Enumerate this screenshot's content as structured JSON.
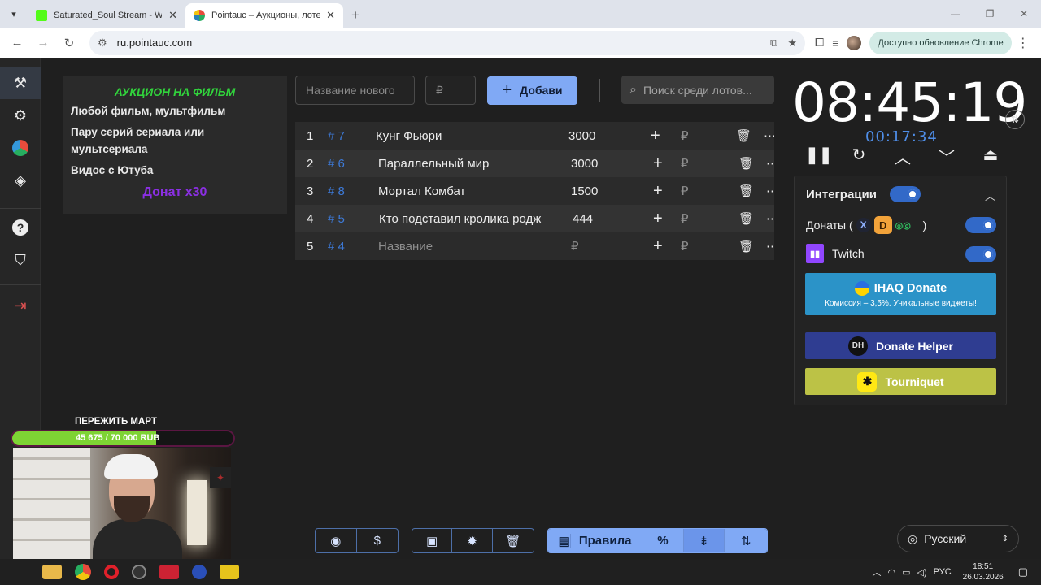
{
  "browser": {
    "tabs": [
      {
        "title": "Saturated_Soul Stream - Watch",
        "active": false
      },
      {
        "title": "Pointauc – Аукционы, лотереи",
        "active": true
      }
    ],
    "url": "ru.pointauc.com",
    "update_label": "Доступно обновление Chrome"
  },
  "rules": {
    "title": "АУКЦИОН НА ФИЛЬМ",
    "lines": [
      "Любой фильм, мультфильм",
      "Пару серий сериала или мультсериала",
      "Видос с Ютуба"
    ],
    "donat": "Донат x30"
  },
  "add_lot": {
    "name_placeholder": "Название нового",
    "amount_placeholder": "₽",
    "add_label": "Добави",
    "search_placeholder": "Поиск среди лотов..."
  },
  "lots": [
    {
      "num": "1",
      "id": "# 7",
      "name": "Кунг Фьюри",
      "amount": "3000"
    },
    {
      "num": "2",
      "id": "# 6",
      "name": "Параллельный мир",
      "amount": "3000"
    },
    {
      "num": "3",
      "id": "# 8",
      "name": "Мортал Комбат",
      "amount": "1500"
    },
    {
      "num": "4",
      "id": "# 5",
      "name": "Кто подставил кролика родж",
      "amount": "444"
    },
    {
      "num": "5",
      "id": "# 4",
      "name": "Название",
      "amount": "₽"
    }
  ],
  "lot_currency": "₽",
  "timer": {
    "main": "08:45:19",
    "elapsed": "00:17:34"
  },
  "integrations": {
    "title": "Интеграции",
    "donations_label": "Донаты (",
    "donations_close": ")",
    "twitch_label": "Twitch",
    "ihaq_title": "IHAQ Donate",
    "ihaq_sub": "Комиссия – 3,5%. Уникальные виджеты!",
    "dh_label": "Donate Helper",
    "tq_label": "Tourniquet"
  },
  "stream_overlay": {
    "goal_title": "ПЕРЕЖИТЬ МАРТ",
    "goal_text": "45 675 / 70 000 RUB",
    "goal_progress": 0.6525
  },
  "toolbar": {
    "rules_label": "Правила"
  },
  "language": "Русский",
  "taskbar": {
    "lang": "РУС",
    "time": "18:51",
    "date": "26.03.2026"
  }
}
